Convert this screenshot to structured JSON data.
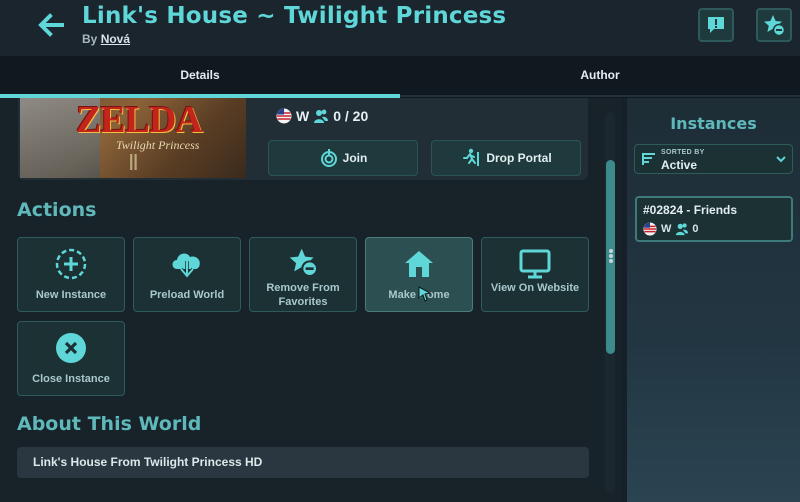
{
  "header": {
    "title": "Link's House ~ Twilight Princess",
    "by_prefix": "By",
    "author": "Nová",
    "back_icon": "arrow-left-icon",
    "report_icon": "report-icon",
    "favorite_icon": "star-minus-icon"
  },
  "tabs": [
    {
      "label": "Details",
      "active": true
    },
    {
      "label": "Author",
      "active": false
    }
  ],
  "world": {
    "thumbnail_logo": "ZELDA",
    "thumbnail_subtitle": "Twilight Princess",
    "region": "W",
    "occupancy": "0 / 20",
    "join_label": "Join",
    "portal_label": "Drop Portal"
  },
  "actions": {
    "title": "Actions",
    "items": [
      {
        "label": "New Instance",
        "icon": "plus-circle-icon"
      },
      {
        "label": "Preload World",
        "icon": "cloud-download-icon"
      },
      {
        "label": "Remove From Favorites",
        "icon": "star-minus-icon"
      },
      {
        "label": "Make Home",
        "icon": "home-icon"
      },
      {
        "label": "View On Website",
        "icon": "monitor-icon"
      },
      {
        "label": "Close Instance",
        "icon": "close-circle-icon"
      }
    ]
  },
  "about": {
    "title": "About This World",
    "text": "Link's House From Twilight Princess HD"
  },
  "instances": {
    "title": "Instances",
    "sort_caption": "SORTED BY",
    "sort_value": "Active",
    "list": [
      {
        "name": "#02824 - Friends",
        "region": "W",
        "users": "0"
      }
    ]
  },
  "colors": {
    "accent": "#5fd6d8",
    "section": "#5fb9bb",
    "tile_bg": "#1b3134",
    "bg": "#182229"
  }
}
